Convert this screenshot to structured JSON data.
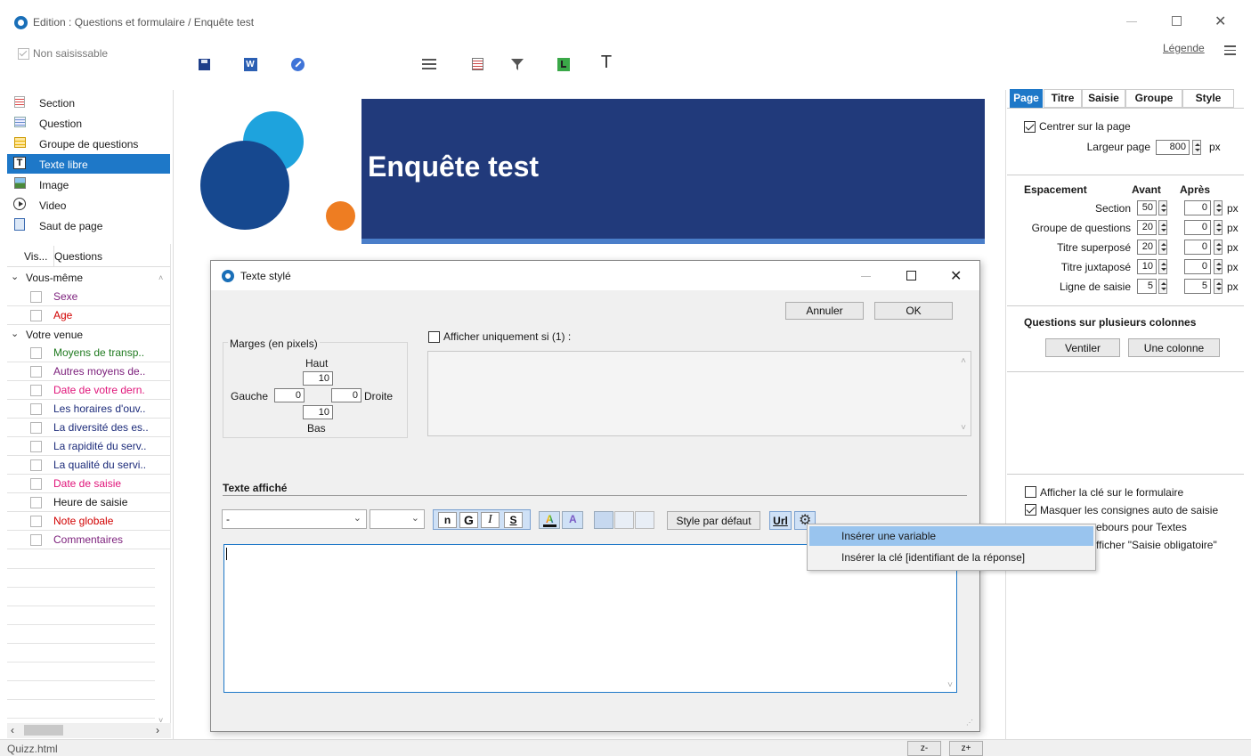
{
  "window": {
    "title": "Edition : Questions et formulaire / Enquête test"
  },
  "toolbar": {
    "non_saisissable": "Non saisissable",
    "legende": "Légende"
  },
  "elements": [
    {
      "label": "Section",
      "icon": "section-icon"
    },
    {
      "label": "Question",
      "icon": "question-icon"
    },
    {
      "label": "Groupe de questions",
      "icon": "question-group-icon"
    },
    {
      "label": "Texte libre",
      "icon": "free-text-icon"
    },
    {
      "label": "Image",
      "icon": "image-icon"
    },
    {
      "label": "Video",
      "icon": "video-icon"
    },
    {
      "label": "Saut de page",
      "icon": "page-break-icon"
    }
  ],
  "questions_header": {
    "vis": "Vis...",
    "questions": "Questions"
  },
  "questions": {
    "group1": "Vous-même",
    "group1_items": [
      {
        "text": "Sexe",
        "color": "#7b1e7b"
      },
      {
        "text": "Age",
        "color": "#d10000"
      }
    ],
    "group2": "Votre venue",
    "group2_items": [
      {
        "text": "Moyens de transp..",
        "color": "#1f7a1f"
      },
      {
        "text": "Autres moyens de..",
        "color": "#7b1e7b"
      },
      {
        "text": "Date de votre dern.",
        "color": "#e0157a"
      },
      {
        "text": "Les horaires d'ouv..",
        "color": "#1c2b7a"
      },
      {
        "text": "La diversité des es..",
        "color": "#1c2b7a"
      },
      {
        "text": "La rapidité du serv..",
        "color": "#1c2b7a"
      },
      {
        "text": "La qualité du servi..",
        "color": "#1c2b7a"
      },
      {
        "text": "Date de saisie",
        "color": "#e0157a"
      },
      {
        "text": "Heure de saisie",
        "color": "#111111"
      },
      {
        "text": "Note globale",
        "color": "#d10000"
      },
      {
        "text": "Commentaires",
        "color": "#7b1e7b"
      }
    ]
  },
  "statusbar": {
    "file": "Quizz.html",
    "zoom_out": "z-",
    "zoom_in": "z+"
  },
  "banner": {
    "title": "Enquête test"
  },
  "dialog": {
    "title": "Texte stylé",
    "cancel": "Annuler",
    "ok": "OK",
    "margins_title": "Marges (en pixels)",
    "top_label": "Haut",
    "bottom_label": "Bas",
    "left_label": "Gauche",
    "right_label": "Droite",
    "top_value": "10",
    "bottom_value": "10",
    "left_value": "0",
    "right_value": "0",
    "show_only_if": "Afficher uniquement si (1) :",
    "displayed_text": "Texte affiché",
    "font_select": "-",
    "fmt_n": "n",
    "fmt_g": "G",
    "fmt_i": "I",
    "fmt_s": "S",
    "default_style": "Style par défaut",
    "url": "Url"
  },
  "context_menu": {
    "item1": "Insérer une variable",
    "item2": "Insérer la clé [identifiant de la réponse]"
  },
  "right_panel": {
    "tabs": [
      "Page",
      "Titre",
      "Saisie",
      "Groupe",
      "Style"
    ],
    "center_page": "Centrer sur la page",
    "page_width_label": "Largeur page",
    "page_width": "800",
    "px": "px",
    "spacing": "Espacement",
    "before": "Avant",
    "after": "Après",
    "rows": [
      {
        "label": "Section",
        "before": "50",
        "after": "0"
      },
      {
        "label": "Groupe de questions",
        "before": "20",
        "after": "0"
      },
      {
        "label": "Titre superposé",
        "before": "20",
        "after": "0"
      },
      {
        "label": "Titre juxtaposé",
        "before": "10",
        "after": "0"
      },
      {
        "label": "Ligne de saisie",
        "before": "5",
        "after": "5"
      }
    ],
    "multi_col_title": "Questions sur plusieurs colonnes",
    "ventiler": "Ventiler",
    "une_colonne": "Une colonne",
    "opt1": "Afficher la clé sur le formulaire",
    "opt2": "Masquer les consignes auto de saisie",
    "opt3": "ebours pour Textes",
    "opt4": "fficher \"Saisie obligatoire\""
  }
}
